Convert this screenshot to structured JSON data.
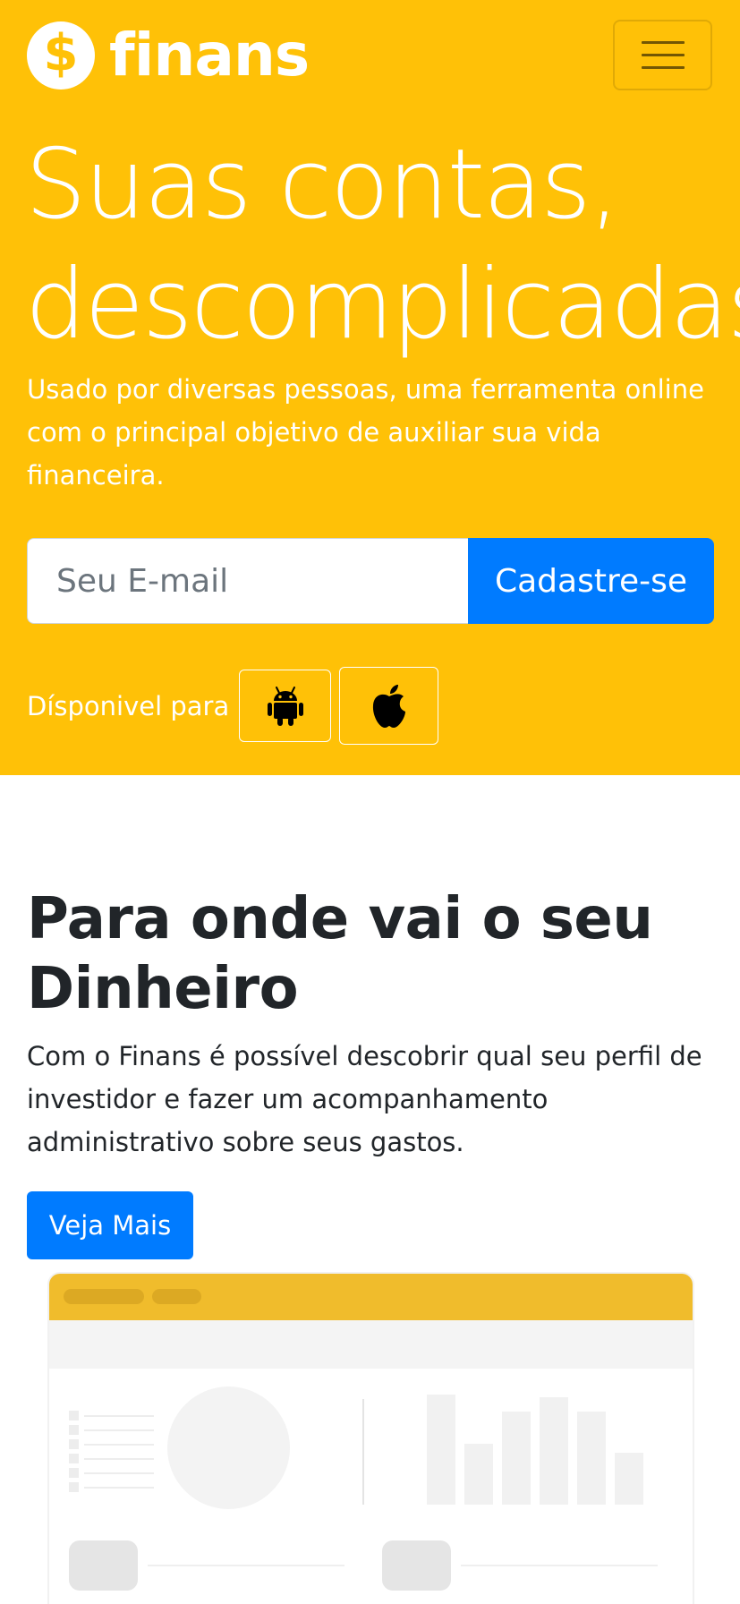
{
  "brand": {
    "name": "finans",
    "coin_symbol": "$",
    "color": "#FFC107"
  },
  "nav": {
    "menu_icon": "hamburger-menu-icon"
  },
  "hero": {
    "title_line1": "Suas contas,",
    "title_line2": "descomplicadas",
    "subtitle": "Usado por diversas pessoas, uma ferramenta online com o principal objetivo de auxiliar sua vida financeira.",
    "email_placeholder": "Seu E-mail",
    "email_value": "",
    "signup_label": "Cadastre-se",
    "available_label": "Dísponivel para",
    "store_icons": [
      "android-icon",
      "apple-icon"
    ]
  },
  "section": {
    "title": "Para onde vai o seu Dinheiro",
    "text": "Com o Finans é possível descobrir qual seu perfil de investidor e fazer um acompanhamento administrativo sobre seus gastos.",
    "button_label": "Veja Mais"
  },
  "colors": {
    "hero_bg": "#FFC107",
    "primary": "#007BFF",
    "mockup_header": "#F0BC2C"
  }
}
